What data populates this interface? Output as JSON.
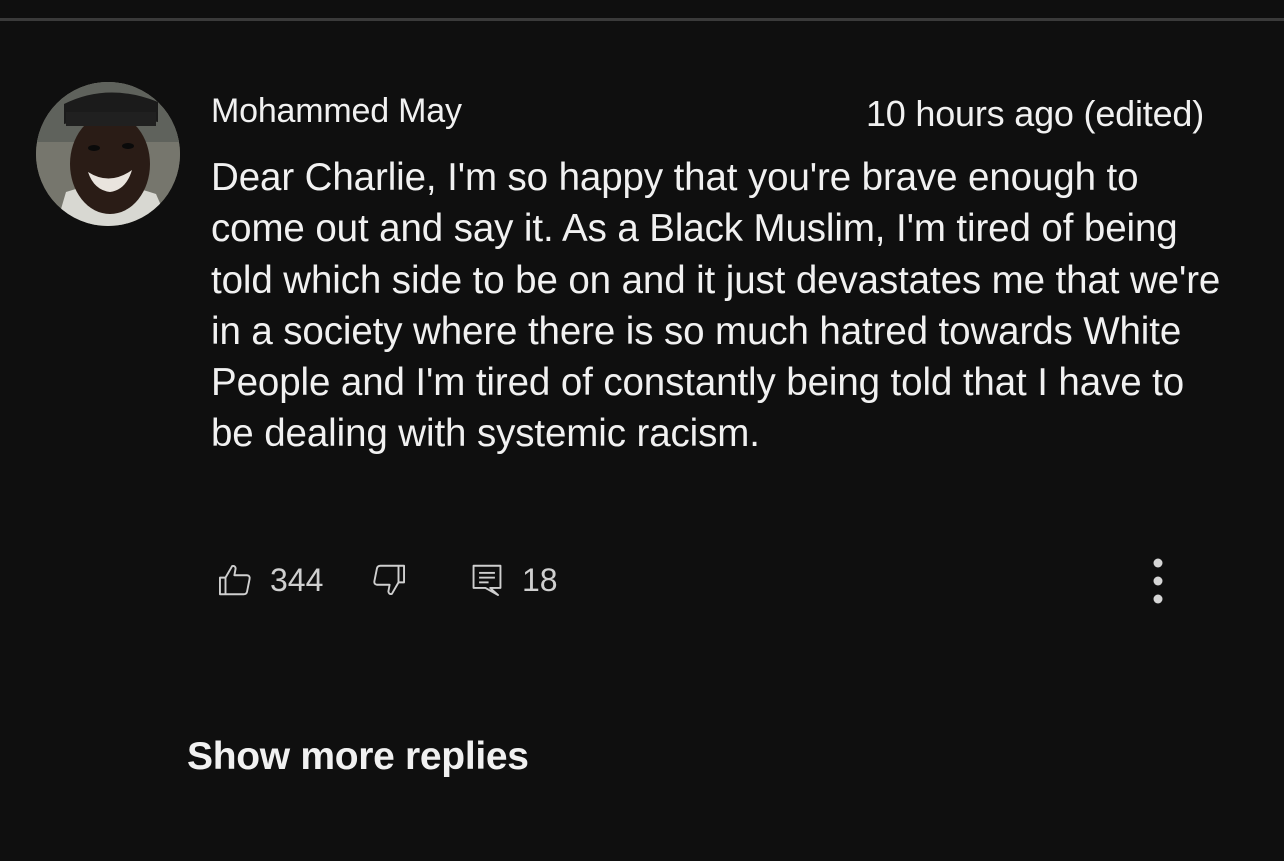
{
  "comment": {
    "author": "Mohammed May",
    "timestamp": "10 hours ago (edited)",
    "text": "Dear Charlie, I'm so happy that you're brave enough to come out and say it. As a Black Muslim, I'm tired of being told which side to be on and it just devastates me that we're in a society where there is so much hatred towards White People and I'm tired of constantly being told that I have to be dealing with systemic racism.",
    "likes": "344",
    "replies": "18"
  },
  "icons": {
    "like": "thumbs-up-icon",
    "dislike": "thumbs-down-icon",
    "reply": "comment-icon",
    "more": "more-vertical-icon"
  },
  "footer": {
    "show_more_label": "Show more replies"
  },
  "colors": {
    "background": "#0f0f0f",
    "text": "#f1f1f1",
    "secondary_text": "#cfcfcf"
  }
}
